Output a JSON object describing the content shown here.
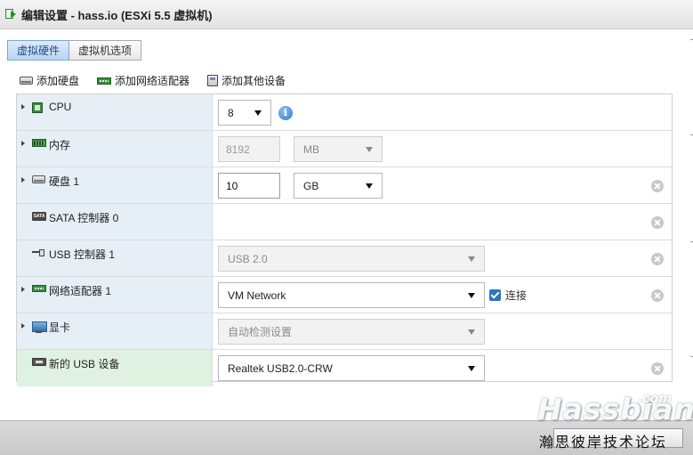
{
  "window": {
    "title": "编辑设置 - hass.io (ESXi 5.5 虚拟机)"
  },
  "tabs": [
    {
      "label": "虚拟硬件",
      "active": true
    },
    {
      "label": "虚拟机选项",
      "active": false
    }
  ],
  "toolbar": {
    "add_disk": "添加硬盘",
    "add_network": "添加网络适配器",
    "add_other": "添加其他设备"
  },
  "rows": {
    "cpu": {
      "label": "CPU",
      "value": "8",
      "icon": "cpu-icon"
    },
    "memory": {
      "label": "内存",
      "value": "8192",
      "unit": "MB",
      "icon": "memory-icon"
    },
    "disk": {
      "label": "硬盘 1",
      "value": "10",
      "unit": "GB",
      "icon": "disk-icon"
    },
    "sata": {
      "label": "SATA 控制器 0",
      "icon": "sata-icon"
    },
    "usb_ctrl": {
      "label": "USB 控制器 1",
      "value": "USB 2.0",
      "icon": "usb-icon"
    },
    "network": {
      "label": "网络适配器 1",
      "value": "VM Network",
      "connect_label": "连接",
      "connected": true,
      "icon": "nic-icon"
    },
    "display": {
      "label": "显卡",
      "value": "自动检测设置",
      "icon": "monitor-icon"
    },
    "usb_dev": {
      "label": "新的 USB 设备",
      "value": "Realtek USB2.0-CRW",
      "icon": "usb-device-icon"
    }
  },
  "watermark": {
    "brand": "Hassbian",
    "suffix": ".com",
    "caption": "瀚思彼岸技术论坛"
  },
  "colors": {
    "active_tab": "#b9d6f3",
    "label_bg": "#e6eff6",
    "highlight_bg": "#dff1e0",
    "checkbox": "#2f74c0"
  }
}
